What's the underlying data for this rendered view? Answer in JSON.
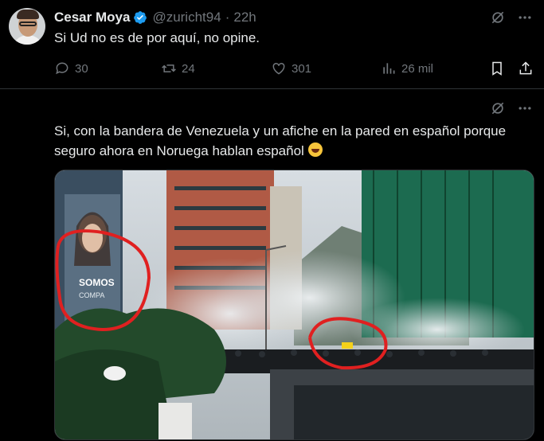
{
  "tweet": {
    "author_name": "Cesar Moya",
    "handle": "@zuricht94",
    "separator": "·",
    "time": "22h",
    "text": "Si Ud no es de por aquí, no opine.",
    "replies": "30",
    "retweets": "24",
    "likes": "301",
    "views": "26 mil",
    "icons": [
      "verified-badge-icon",
      "grok-icon",
      "more-icon",
      "reply-icon",
      "retweet-icon",
      "like-icon",
      "views-icon",
      "bookmark-icon",
      "share-icon"
    ]
  },
  "quoted_post": {
    "text": "Si, con la bandera de Venezuela y un afiche en la pared en español porque seguro ahora en Noruega hablan español",
    "emoji": "rolling-on-floor-laughing",
    "image": {
      "billboard_text": [
        "SOMOS",
        "COMPA"
      ],
      "annotation_color": "#e02020",
      "description_icons": [
        "billboard",
        "buildings",
        "tear-gas-smoke",
        "crowd",
        "flag"
      ]
    },
    "icons": [
      "grok-icon",
      "more-icon"
    ]
  },
  "colors": {
    "background": "#000000",
    "text": "#e7e9ea",
    "secondary": "#71767b",
    "verified": "#1d9bf0",
    "divider": "#2f3336"
  }
}
